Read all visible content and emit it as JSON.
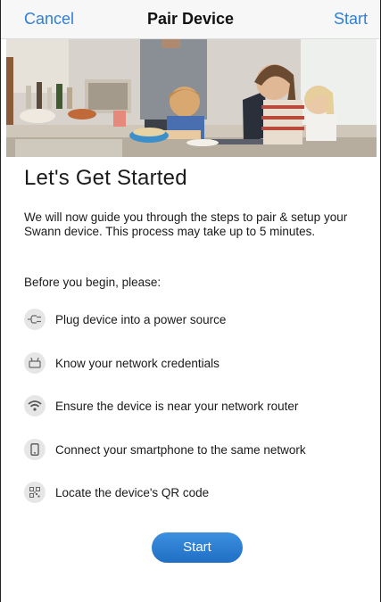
{
  "navbar": {
    "cancel_label": "Cancel",
    "title": "Pair Device",
    "start_label": "Start"
  },
  "main": {
    "heading": "Let's Get Started",
    "intro": "We will now guide you through the steps to pair & setup your Swann device. This process may take up to 5 minutes.",
    "before_label": "Before you begin, please:",
    "steps": [
      {
        "label": "Plug device into a power source",
        "icon": "plug-icon"
      },
      {
        "label": "Know your network credentials",
        "icon": "router-icon"
      },
      {
        "label": "Ensure the device is near your network router",
        "icon": "wifi-icon"
      },
      {
        "label": "Connect your smartphone to the same network",
        "icon": "smartphone-icon"
      },
      {
        "label": "Locate the device's QR code",
        "icon": "qr-code-icon"
      }
    ],
    "start_button_label": "Start"
  },
  "colors": {
    "accent": "#2f7fd9",
    "button": "#2a7bd0",
    "icon_bg": "#e6e6e6"
  }
}
